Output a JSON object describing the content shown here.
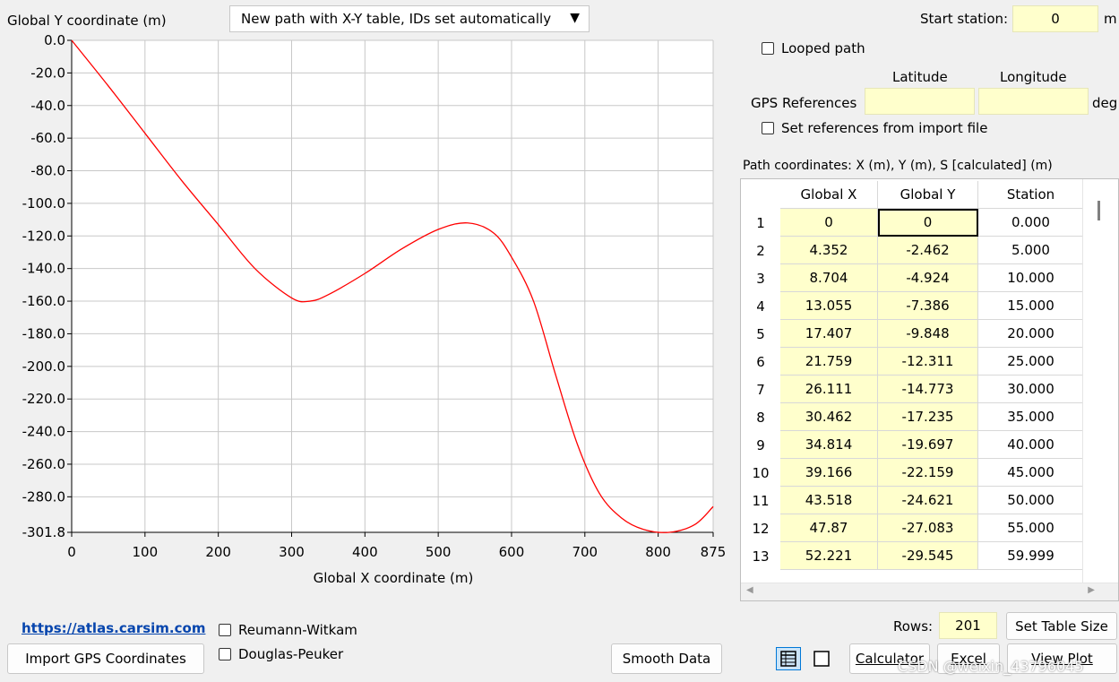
{
  "header": {
    "y_axis_title": "Global Y coordinate (m)",
    "path_type_select": "New path with X-Y table, IDs set automatically",
    "start_station_label": "Start station:",
    "start_station_value": "0",
    "start_station_unit": "m"
  },
  "options": {
    "looped_path_label": "Looped path",
    "gps_col_latitude": "Latitude",
    "gps_col_longitude": "Longitude",
    "gps_references_label": "GPS References",
    "gps_latitude_value": "",
    "gps_longitude_value": "",
    "gps_unit": "deg",
    "set_refs_label": "Set references from import file"
  },
  "table": {
    "caption": "Path coordinates: X (m), Y (m), S [calculated] (m)",
    "headers": [
      "Global X",
      "Global Y",
      "Station"
    ],
    "rows": [
      {
        "idx": "1",
        "x": "0",
        "y": "0",
        "s": "0.000"
      },
      {
        "idx": "2",
        "x": "4.352",
        "y": "-2.462",
        "s": "5.000"
      },
      {
        "idx": "3",
        "x": "8.704",
        "y": "-4.924",
        "s": "10.000"
      },
      {
        "idx": "4",
        "x": "13.055",
        "y": "-7.386",
        "s": "15.000"
      },
      {
        "idx": "5",
        "x": "17.407",
        "y": "-9.848",
        "s": "20.000"
      },
      {
        "idx": "6",
        "x": "21.759",
        "y": "-12.311",
        "s": "25.000"
      },
      {
        "idx": "7",
        "x": "26.111",
        "y": "-14.773",
        "s": "30.000"
      },
      {
        "idx": "8",
        "x": "30.462",
        "y": "-17.235",
        "s": "35.000"
      },
      {
        "idx": "9",
        "x": "34.814",
        "y": "-19.697",
        "s": "40.000"
      },
      {
        "idx": "10",
        "x": "39.166",
        "y": "-22.159",
        "s": "45.000"
      },
      {
        "idx": "11",
        "x": "43.518",
        "y": "-24.621",
        "s": "50.000"
      },
      {
        "idx": "12",
        "x": "47.87",
        "y": "-27.083",
        "s": "55.000"
      },
      {
        "idx": "13",
        "x": "52.221",
        "y": "-29.545",
        "s": "59.999"
      }
    ],
    "rows_label": "Rows:",
    "rows_value": "201"
  },
  "chart_data": {
    "type": "line",
    "xlabel": "Global X coordinate (m)",
    "ylabel": "Global Y coordinate (m)",
    "xlim": [
      0,
      875
    ],
    "ylim": [
      -301.8,
      0
    ],
    "x_ticks": [
      "0",
      "100",
      "200",
      "300",
      "400",
      "500",
      "600",
      "700",
      "800",
      "875"
    ],
    "y_ticks": [
      "0.0",
      "-20.0",
      "-40.0",
      "-60.0",
      "-80.0",
      "-100.0",
      "-120.0",
      "-140.0",
      "-160.0",
      "-180.0",
      "-200.0",
      "-220.0",
      "-240.0",
      "-260.0",
      "-280.0",
      "-301.8"
    ],
    "grid": true,
    "line_color": "#ff0000",
    "series": [
      {
        "x": [
          0,
          50,
          100,
          150,
          200,
          250,
          300,
          325,
          350,
          400,
          450,
          500,
          540,
          575,
          600,
          630,
          660,
          690,
          720,
          750,
          780,
          815,
          850,
          875
        ],
        "y": [
          0,
          -28,
          -57,
          -86,
          -113,
          -140,
          -158,
          -160,
          -156,
          -143,
          -128,
          -116,
          -112,
          -118,
          -133,
          -160,
          -205,
          -248,
          -278,
          -293,
          -300,
          -301.8,
          -297,
          -286
        ]
      }
    ]
  },
  "footer": {
    "link_text": "https://atlas.carsim.com",
    "import_button": "Import GPS Coordinates",
    "reumann_label": "Reumann-Witkam",
    "douglas_label": "Douglas-Peuker",
    "smooth_button": "Smooth Data",
    "set_table_size_button": "Set Table Size",
    "calculator_button": "Calculator",
    "excel_button": "Excel",
    "view_plot_button": "View Plot",
    "watermark": "CSDN @weixin_43796045"
  }
}
